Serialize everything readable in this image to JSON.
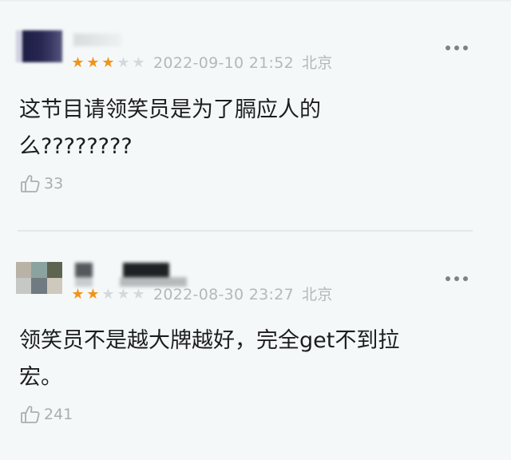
{
  "reviews": [
    {
      "stars_on": 3,
      "stars_total": 5,
      "datetime": "2022-09-10 21:52",
      "location": "北京",
      "text": "这节目请领笑员是为了膈应人的\n么????????",
      "likes": "33",
      "more_icon": "more-horizontal-icon",
      "like_icon": "thumbs-up-icon"
    },
    {
      "stars_on": 2,
      "stars_total": 5,
      "datetime": "2022-08-30 23:27",
      "location": "北京",
      "text": "领笑员不是越大牌越好，完全get不到拉\n宏。",
      "likes": "241",
      "more_icon": "more-horizontal-icon",
      "like_icon": "thumbs-up-icon"
    }
  ],
  "colors": {
    "background": "#f5f8f9",
    "star_on": "#f0941a",
    "star_off": "#d6d9db",
    "meta_text": "#b3b8bb",
    "body_text": "#1b1d1e"
  }
}
